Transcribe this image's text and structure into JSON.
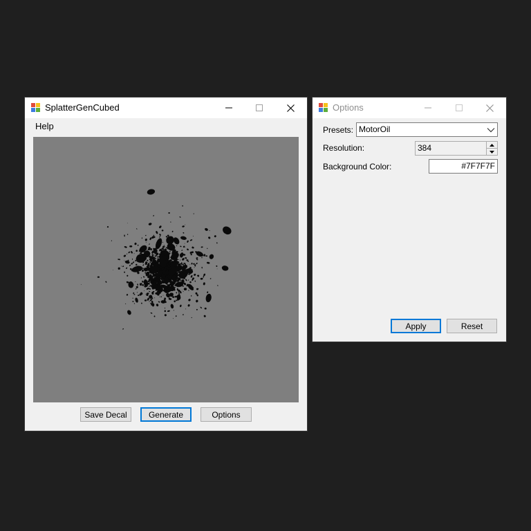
{
  "main_window": {
    "title": "SplatterGenCubed",
    "app_icon": "windows-forms-icon",
    "controls": {
      "minimize": "minimize-icon",
      "maximize": "maximize-icon",
      "close": "close-icon"
    },
    "menu": {
      "help": "Help"
    },
    "preview": {
      "background_color": "#7F7F7F",
      "splatter_color": "#0a0a0a"
    },
    "buttons": {
      "save_decal": "Save Decal",
      "generate": "Generate",
      "options": "Options"
    }
  },
  "options_window": {
    "title": "Options",
    "app_icon": "windows-forms-icon",
    "controls": {
      "minimize": "minimize-icon",
      "maximize": "maximize-icon",
      "close": "close-icon"
    },
    "presets_label": "Presets:",
    "presets_value": "MotorOil",
    "resolution_label": "Resolution:",
    "resolution_value": "384",
    "background_color_label": "Background Color:",
    "background_color_value": "#7F7F7F",
    "buttons": {
      "apply": "Apply",
      "reset": "Reset"
    }
  },
  "colors": {
    "desktop": "#1f1f1f",
    "window": "#f0f0f0",
    "accent": "#0078d7"
  }
}
